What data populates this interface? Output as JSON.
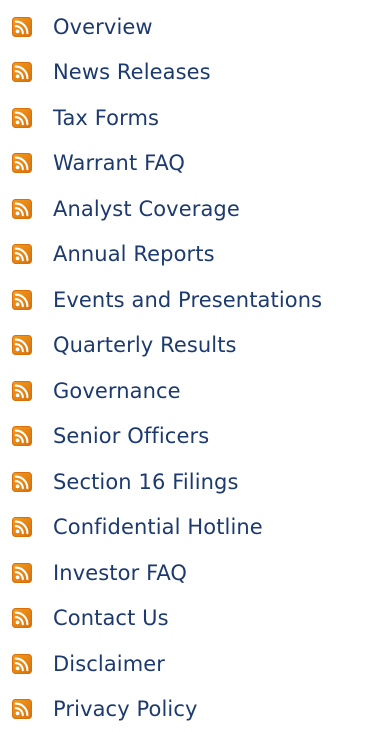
{
  "feed_icon": {
    "name": "rss-feed-icon",
    "color": "#f39c1e",
    "color_dark": "#d9700a",
    "glyph_color": "#ffffff"
  },
  "link_color": "#1d3a6e",
  "feeds": [
    {
      "label": "Overview"
    },
    {
      "label": "News Releases"
    },
    {
      "label": "Tax Forms"
    },
    {
      "label": "Warrant FAQ"
    },
    {
      "label": "Analyst Coverage"
    },
    {
      "label": "Annual Reports"
    },
    {
      "label": "Events and Presentations"
    },
    {
      "label": "Quarterly Results"
    },
    {
      "label": "Governance"
    },
    {
      "label": "Senior Officers"
    },
    {
      "label": "Section 16 Filings"
    },
    {
      "label": "Confidential Hotline"
    },
    {
      "label": "Investor FAQ"
    },
    {
      "label": "Contact Us"
    },
    {
      "label": "Disclaimer"
    },
    {
      "label": "Privacy Policy"
    }
  ]
}
